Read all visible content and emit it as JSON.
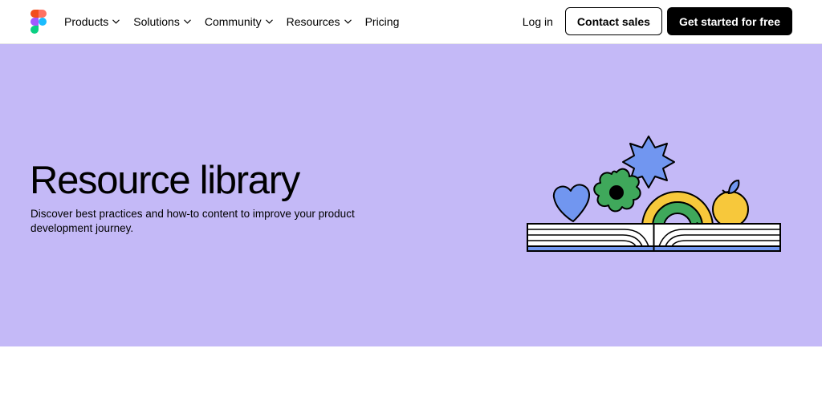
{
  "nav": {
    "logo_name": "figma-logo",
    "links": [
      {
        "label": "Products",
        "has_dropdown": true
      },
      {
        "label": "Solutions",
        "has_dropdown": true
      },
      {
        "label": "Community",
        "has_dropdown": true
      },
      {
        "label": "Resources",
        "has_dropdown": true
      },
      {
        "label": "Pricing",
        "has_dropdown": false
      }
    ],
    "login_label": "Log in",
    "contact_label": "Contact sales",
    "cta_label": "Get started for free"
  },
  "hero": {
    "title": "Resource library",
    "subtitle": "Discover best practices and how-to content to improve your product development journey.",
    "background_color": "#c4b9f7"
  },
  "colors": {
    "brand_black": "#000000",
    "hero_purple": "#c4b9f7",
    "illustration_blue": "#7196f0",
    "illustration_green": "#3fa85b",
    "illustration_yellow": "#f7c83b",
    "figma_red": "#f24e1e",
    "figma_orange": "#ff7262",
    "figma_purple": "#a259ff",
    "figma_blue": "#1abcfe",
    "figma_green": "#0acf83"
  }
}
